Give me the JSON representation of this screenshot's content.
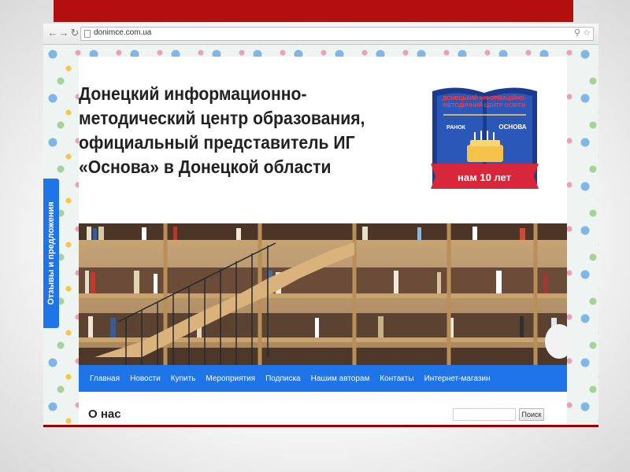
{
  "browser": {
    "url": "donimce.com.ua",
    "back_icon": "back-arrow-icon",
    "forward_icon": "forward-arrow-icon",
    "reload_icon": "reload-icon",
    "zoom_icon": "zoom-icon",
    "bookmark_icon": "star-icon"
  },
  "site": {
    "title": "Донецкий информационно-методический центр образования, официальный представитель ИГ «Основа» в Донецкой области",
    "logo": {
      "line1": "ДОНЕЦЬКИЙ ІНФОРМАЦІЙНО-",
      "line2": "МЕТОДИЧНИЙ ЦЕНТР ОСВІТИ",
      "brand1": "РАНОК",
      "brand2": "ОСНОВА",
      "badge": "нам 10 лет"
    }
  },
  "nav": {
    "items": [
      "Главная",
      "Новости",
      "Купить",
      "Мероприятия",
      "Подписка",
      "Нашим авторам",
      "Контакты",
      "Интернет-магазин"
    ]
  },
  "main": {
    "heading": "О нас"
  },
  "search": {
    "placeholder": "",
    "button_label": "Поиск"
  },
  "feedback_tab": {
    "label": "Отзывы и предложения"
  },
  "colors": {
    "slide_bar": "#b30f0f",
    "nav_blue": "#1f74e8",
    "logo_red": "#d8263a",
    "logo_blue": "#1a3c8e"
  }
}
